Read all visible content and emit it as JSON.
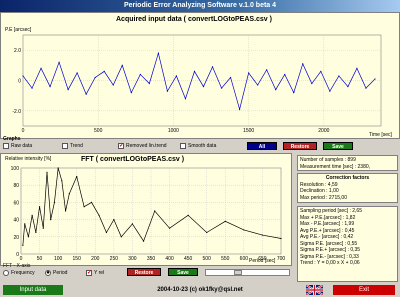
{
  "window": {
    "title": "Periodic Error Analyzing Software v.1.0 beta 4"
  },
  "top_plot": {
    "title": "Acquired input data ( convertLOGtoPEAS.csv )",
    "ylabel": "P.E [arcsec]",
    "xlabel": "Time [sec]",
    "y_ticks": [
      "2.0",
      "0",
      "-2.0"
    ],
    "x_ticks": [
      "0",
      "500",
      "1000",
      "1500",
      "2000"
    ]
  },
  "graphs_group": {
    "label": "Graphs",
    "raw_data": "Raw data",
    "trend": "Trend",
    "removed_lin_trend": "Removed lin.trend",
    "smooth_data": "Smooth data",
    "all_button": "All",
    "restore_button": "Restore",
    "save_button": "Save"
  },
  "fft_plot": {
    "title": "FFT ( convertLOGtoPEAS.csv )",
    "ylabel": "Relative intensity [%]",
    "xlabel": "Period [sec]",
    "y_ticks": [
      "100",
      "80",
      "60",
      "40",
      "20",
      "0"
    ],
    "x_ticks": [
      "0",
      "50",
      "100",
      "150",
      "200",
      "250",
      "300",
      "350",
      "400",
      "450",
      "500",
      "550",
      "600",
      "650",
      "700"
    ]
  },
  "fft_controls": {
    "xaxis_label": "FFT - X-axis",
    "frequency": "Frequency",
    "period": "Period",
    "yrel": "Y rel",
    "restore_button": "Restore",
    "save_button": "Save"
  },
  "stats": {
    "samples": "Number of samples : 899",
    "measurement_time": "Measurement time [sec] : 2380,"
  },
  "correction": {
    "title": "Correction factors",
    "resolution": "Resolution : 4,59",
    "declination": "Declination : 1,00",
    "max_period": "Max period : 2715,00"
  },
  "results": {
    "sampling_period": "Sampling period [sec] : 2,65",
    "max_pe": "Max + P.E.[arcsec] : 1,82",
    "min_pe": "Max - P.E.[arcsec] : 1,99",
    "avg_pe_plus": "Avg P.E.+ [arcsec] : 0,45",
    "avg_pe_minus": "Avg P.E.- [arcsec] : 0,42",
    "sigma_pe": "Sigma P.E. [arcsec] : 0,55",
    "sigma_pe_plus": "Sigma P.E.+ [arcsec] : 0,35",
    "sigma_pe_minus": "Sigma P.E.- [arcsec] : 0,33",
    "trend": "Trend : Y = 0,00 x X + 0,06"
  },
  "footer": {
    "input_button": "Input data",
    "credit": "2004-10-23 (c) ok1fky@qsl.net",
    "exit_button": "Exit"
  },
  "colors": {
    "plot_bg": "#ffffe0",
    "series": "#0000cc",
    "fft_series": "#000000"
  },
  "chart_data": [
    {
      "type": "line",
      "title": "Acquired input data ( convertLOGtoPEAS.csv )",
      "xlabel": "Time [sec]",
      "ylabel": "P.E [arcsec]",
      "xlim": [
        0,
        2380
      ],
      "ylim": [
        -3,
        3
      ],
      "grid": true,
      "series": [
        {
          "x": [
            0,
            60,
            120,
            180,
            240,
            300,
            360,
            420,
            480,
            540,
            600,
            660,
            720,
            780,
            840,
            900,
            960,
            1020,
            1080,
            1140,
            1200,
            1260,
            1320,
            1380,
            1440,
            1500,
            1560,
            1620,
            1680,
            1740,
            1800,
            1860,
            1920,
            1980,
            2040,
            2100,
            2160,
            2220,
            2280,
            2340
          ],
          "y": [
            0.3,
            -0.5,
            0.8,
            -0.4,
            1.2,
            -0.6,
            0.5,
            -0.9,
            0.2,
            0.6,
            -0.3,
            1.0,
            -0.8,
            0.4,
            -0.2,
            1.8,
            -0.7,
            0.3,
            -1.2,
            0.6,
            -0.4,
            0.9,
            -0.5,
            0.2,
            -1.9,
            0.5,
            -0.3,
            0.7,
            -0.6,
            0.4,
            -0.8,
            1.1,
            -0.2,
            0.6,
            -0.7,
            0.3,
            -0.4,
            0.8,
            -0.5,
            0.1
          ]
        }
      ]
    },
    {
      "type": "line",
      "title": "FFT ( convertLOGtoPEAS.csv )",
      "xlabel": "Period [sec]",
      "ylabel": "Relative intensity [%]",
      "xlim": [
        0,
        700
      ],
      "ylim": [
        0,
        100
      ],
      "grid": true,
      "series": [
        {
          "x": [
            5,
            10,
            20,
            30,
            40,
            50,
            60,
            70,
            80,
            90,
            100,
            110,
            120,
            130,
            150,
            170,
            190,
            210,
            230,
            250,
            270,
            300,
            330,
            360,
            400,
            450,
            500,
            550,
            600,
            650,
            700
          ],
          "y": [
            10,
            35,
            20,
            45,
            25,
            55,
            30,
            95,
            40,
            60,
            100,
            85,
            50,
            70,
            90,
            55,
            60,
            45,
            25,
            40,
            20,
            35,
            15,
            50,
            30,
            45,
            25,
            38,
            28,
            22,
            18
          ]
        }
      ]
    }
  ]
}
